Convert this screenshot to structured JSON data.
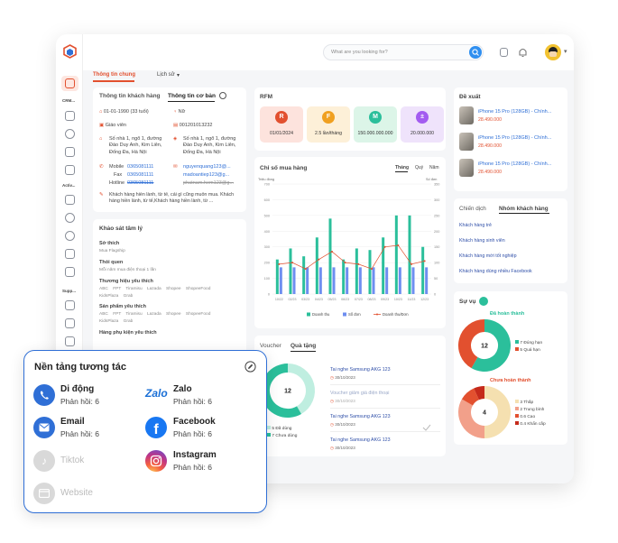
{
  "search": {
    "placeholder": "What are you looking for?"
  },
  "sidebar": {
    "crm_label": "CRM...",
    "activ_label": "Activ...",
    "supp_label": "Supp..."
  },
  "tabs": {
    "general": "Thông tin chung",
    "history": "Lịch sử"
  },
  "customer": {
    "tab_info": "Thông tin khách hàng",
    "tab_basic": "Thông tin cơ bản",
    "dob": "01-01-1990 (33 tuổi)",
    "gender": "Nữ",
    "job": "Giáo viên",
    "id_no": "001201013232",
    "address1": "Số nhà 1, ngõ 1, đường Đào Duy Anh, Kim Liên, Đống Đa, Hà Nội",
    "address2": "Số nhà 1, ngõ 1, đường Đào Duy Anh, Kim Liên, Đống Đa, Hà Nội",
    "mobile_label": "Mobile",
    "mobile": "0365081111",
    "fax_label": "Fax",
    "fax": "0365081111",
    "hotline_label": "Hotline",
    "hotline": "0365081111",
    "email1": "nguyenquang123@...",
    "email2": "madoantiep123@g...",
    "email3": "phatnam.hem123@g...",
    "note": "Khách hàng hiền lành, từ tế, cái gì cũng muốn mua. Khách hàng hiền lành, từ tế,Khách hàng hiền lành, từ ..."
  },
  "survey": {
    "title": "Khảo sát tâm lý",
    "hobby_label": "Sở thích",
    "hobby": "Mua Flagship",
    "habit_label": "Thói quen",
    "habit": "Mỗi năm mua điện thoại 1 lần",
    "brands_label": "Thương hiệu yêu thích",
    "brands1": "ABC    FPT    Tiramisu    Lazada    Shopee    ShopeeFood",
    "brands2": "KidsPlaza    Grab",
    "products_label": "Sản phẩm yêu thích",
    "products1": "ABC    FPT    Tiramisu    Lazada    Shopee    ShopeeFood",
    "products2": "KidsPlaza    Grab",
    "payment_label": "Hàng phụ kiện yêu thích"
  },
  "rfm": {
    "title": "RFM",
    "items": [
      {
        "letter": "R",
        "value": "01/01/2024"
      },
      {
        "letter": "F",
        "value": "2.5 lần/tháng"
      },
      {
        "letter": "M",
        "value": "150.000.000.000"
      },
      {
        "letter": "±",
        "value": "20.000.000"
      }
    ]
  },
  "chart_card": {
    "title": "Chỉ số mua hàng",
    "periods": [
      "Tháng",
      "Quý",
      "Năm"
    ]
  },
  "chart_data": {
    "type": "bar",
    "categories": [
      "10/22",
      "02/23",
      "03/23",
      "04/23",
      "05/23",
      "06/23",
      "07/23",
      "08/23",
      "09/23",
      "10/23",
      "11/23",
      "12/23"
    ],
    "series": [
      {
        "name": "Doanh thu",
        "type": "bar",
        "values": [
          220,
          290,
          240,
          360,
          480,
          220,
          290,
          280,
          360,
          500,
          500,
          300
        ]
      },
      {
        "name": "Số đơn",
        "type": "bar",
        "values": [
          170,
          170,
          170,
          170,
          170,
          170,
          170,
          170,
          170,
          170,
          170,
          170
        ]
      },
      {
        "name": "Doanh thu/Đơn",
        "type": "line",
        "values": [
          190,
          200,
          160,
          220,
          270,
          200,
          190,
          160,
          300,
          310,
          190,
          210
        ]
      }
    ],
    "ylabel": "Triệu đồng",
    "y2label": "Số đơn",
    "ylim": [
      0,
      700
    ],
    "yticks": [
      "0",
      "100",
      "200",
      "300",
      "400",
      "500",
      "600",
      "700"
    ],
    "y2ticks": [
      "0",
      "50",
      "100",
      "150",
      "200",
      "250",
      "300",
      "350"
    ],
    "colors": {
      "bar": "#2bbf9b",
      "bar2": "#6e8ef0",
      "line": "#e2502f"
    },
    "grid": true,
    "legend": "bottom"
  },
  "voucher": {
    "tab1": "Voucher",
    "tab2": "Quà tặng",
    "center": "12",
    "legend1": "5 Đã dùng",
    "legend2": "7 Chưa dùng",
    "items": [
      {
        "title": "Tai nghe Samsung AKG 123",
        "date": "30/10/2023"
      },
      {
        "title": "Voucher giảm giá điện thoại",
        "date": "30/10/2023"
      },
      {
        "title": "Tai nghe Samsung AKG 123",
        "date": "30/10/2023"
      },
      {
        "title": "Tai nghe Samsung AKG 123",
        "date": "30/10/2023"
      }
    ]
  },
  "suggest": {
    "title": "Đề xuất",
    "items": [
      {
        "name": "iPhone 15 Pro (128GB) - Chính...",
        "price": "28.490.000"
      },
      {
        "name": "iPhone 15 Pro (128GB) - Chính...",
        "price": "28.490.000"
      },
      {
        "name": "iPhone 15 Pro (128GB) - Chính...",
        "price": "28.490.000"
      }
    ]
  },
  "campaign": {
    "tab1": "Chiến dịch",
    "tab2": "Nhóm khách hàng",
    "items": [
      "Khách hàng trẻ",
      "Khách hàng sinh viên",
      "Khách hàng mới tốt nghiệp",
      "Khách hàng dùng nhiều Facebook"
    ]
  },
  "service": {
    "title": "Sự vụ",
    "done_title": "Đã hoàn thành",
    "done_center": "12",
    "done_legend": [
      "7 Đúng hạn",
      "5 Quá hạn"
    ],
    "todo_title": "Chưa hoàn thành",
    "todo_center": "4",
    "todo_legend": [
      "3 Thấp",
      "2 Trung bình",
      "0.6 Cao",
      "0.4 Khẩn cấp"
    ]
  },
  "platform": {
    "title": "Nền tảng tương tác",
    "items": [
      {
        "name": "Di động",
        "sub": "Phản hồi: 6"
      },
      {
        "name": "Zalo",
        "sub": "Phản hồi: 6"
      },
      {
        "name": "Email",
        "sub": "Phản hồi: 6"
      },
      {
        "name": "Facebook",
        "sub": "Phản hồi: 6"
      },
      {
        "name": "Tiktok",
        "sub": ""
      },
      {
        "name": "Instagram",
        "sub": "Phản hồi: 6"
      },
      {
        "name": "Website",
        "sub": ""
      }
    ],
    "zalo_logo": "Zalo"
  }
}
